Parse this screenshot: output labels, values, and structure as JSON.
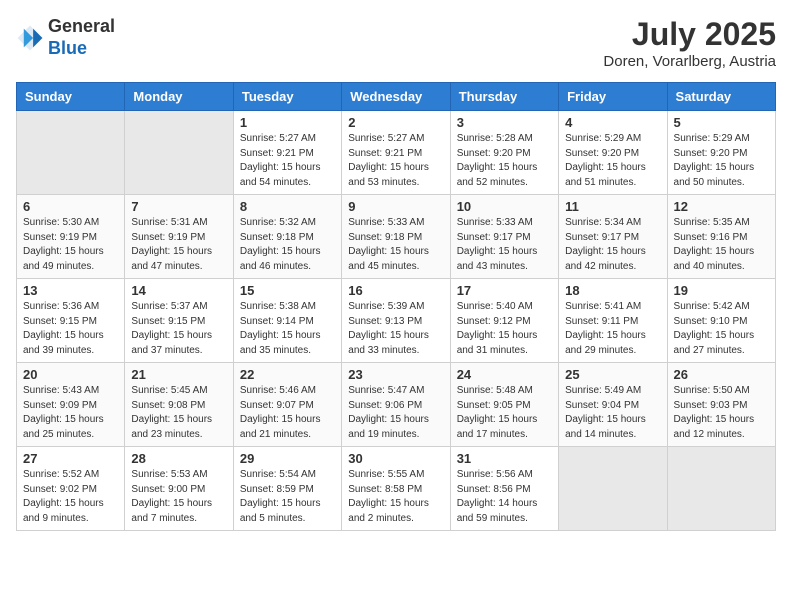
{
  "header": {
    "logo_line1": "General",
    "logo_line2": "Blue",
    "month_year": "July 2025",
    "location": "Doren, Vorarlberg, Austria"
  },
  "weekdays": [
    "Sunday",
    "Monday",
    "Tuesday",
    "Wednesday",
    "Thursday",
    "Friday",
    "Saturday"
  ],
  "weeks": [
    [
      {
        "day": "",
        "info": ""
      },
      {
        "day": "",
        "info": ""
      },
      {
        "day": "1",
        "info": "Sunrise: 5:27 AM\nSunset: 9:21 PM\nDaylight: 15 hours\nand 54 minutes."
      },
      {
        "day": "2",
        "info": "Sunrise: 5:27 AM\nSunset: 9:21 PM\nDaylight: 15 hours\nand 53 minutes."
      },
      {
        "day": "3",
        "info": "Sunrise: 5:28 AM\nSunset: 9:20 PM\nDaylight: 15 hours\nand 52 minutes."
      },
      {
        "day": "4",
        "info": "Sunrise: 5:29 AM\nSunset: 9:20 PM\nDaylight: 15 hours\nand 51 minutes."
      },
      {
        "day": "5",
        "info": "Sunrise: 5:29 AM\nSunset: 9:20 PM\nDaylight: 15 hours\nand 50 minutes."
      }
    ],
    [
      {
        "day": "6",
        "info": "Sunrise: 5:30 AM\nSunset: 9:19 PM\nDaylight: 15 hours\nand 49 minutes."
      },
      {
        "day": "7",
        "info": "Sunrise: 5:31 AM\nSunset: 9:19 PM\nDaylight: 15 hours\nand 47 minutes."
      },
      {
        "day": "8",
        "info": "Sunrise: 5:32 AM\nSunset: 9:18 PM\nDaylight: 15 hours\nand 46 minutes."
      },
      {
        "day": "9",
        "info": "Sunrise: 5:33 AM\nSunset: 9:18 PM\nDaylight: 15 hours\nand 45 minutes."
      },
      {
        "day": "10",
        "info": "Sunrise: 5:33 AM\nSunset: 9:17 PM\nDaylight: 15 hours\nand 43 minutes."
      },
      {
        "day": "11",
        "info": "Sunrise: 5:34 AM\nSunset: 9:17 PM\nDaylight: 15 hours\nand 42 minutes."
      },
      {
        "day": "12",
        "info": "Sunrise: 5:35 AM\nSunset: 9:16 PM\nDaylight: 15 hours\nand 40 minutes."
      }
    ],
    [
      {
        "day": "13",
        "info": "Sunrise: 5:36 AM\nSunset: 9:15 PM\nDaylight: 15 hours\nand 39 minutes."
      },
      {
        "day": "14",
        "info": "Sunrise: 5:37 AM\nSunset: 9:15 PM\nDaylight: 15 hours\nand 37 minutes."
      },
      {
        "day": "15",
        "info": "Sunrise: 5:38 AM\nSunset: 9:14 PM\nDaylight: 15 hours\nand 35 minutes."
      },
      {
        "day": "16",
        "info": "Sunrise: 5:39 AM\nSunset: 9:13 PM\nDaylight: 15 hours\nand 33 minutes."
      },
      {
        "day": "17",
        "info": "Sunrise: 5:40 AM\nSunset: 9:12 PM\nDaylight: 15 hours\nand 31 minutes."
      },
      {
        "day": "18",
        "info": "Sunrise: 5:41 AM\nSunset: 9:11 PM\nDaylight: 15 hours\nand 29 minutes."
      },
      {
        "day": "19",
        "info": "Sunrise: 5:42 AM\nSunset: 9:10 PM\nDaylight: 15 hours\nand 27 minutes."
      }
    ],
    [
      {
        "day": "20",
        "info": "Sunrise: 5:43 AM\nSunset: 9:09 PM\nDaylight: 15 hours\nand 25 minutes."
      },
      {
        "day": "21",
        "info": "Sunrise: 5:45 AM\nSunset: 9:08 PM\nDaylight: 15 hours\nand 23 minutes."
      },
      {
        "day": "22",
        "info": "Sunrise: 5:46 AM\nSunset: 9:07 PM\nDaylight: 15 hours\nand 21 minutes."
      },
      {
        "day": "23",
        "info": "Sunrise: 5:47 AM\nSunset: 9:06 PM\nDaylight: 15 hours\nand 19 minutes."
      },
      {
        "day": "24",
        "info": "Sunrise: 5:48 AM\nSunset: 9:05 PM\nDaylight: 15 hours\nand 17 minutes."
      },
      {
        "day": "25",
        "info": "Sunrise: 5:49 AM\nSunset: 9:04 PM\nDaylight: 15 hours\nand 14 minutes."
      },
      {
        "day": "26",
        "info": "Sunrise: 5:50 AM\nSunset: 9:03 PM\nDaylight: 15 hours\nand 12 minutes."
      }
    ],
    [
      {
        "day": "27",
        "info": "Sunrise: 5:52 AM\nSunset: 9:02 PM\nDaylight: 15 hours\nand 9 minutes."
      },
      {
        "day": "28",
        "info": "Sunrise: 5:53 AM\nSunset: 9:00 PM\nDaylight: 15 hours\nand 7 minutes."
      },
      {
        "day": "29",
        "info": "Sunrise: 5:54 AM\nSunset: 8:59 PM\nDaylight: 15 hours\nand 5 minutes."
      },
      {
        "day": "30",
        "info": "Sunrise: 5:55 AM\nSunset: 8:58 PM\nDaylight: 15 hours\nand 2 minutes."
      },
      {
        "day": "31",
        "info": "Sunrise: 5:56 AM\nSunset: 8:56 PM\nDaylight: 14 hours\nand 59 minutes."
      },
      {
        "day": "",
        "info": ""
      },
      {
        "day": "",
        "info": ""
      }
    ]
  ]
}
